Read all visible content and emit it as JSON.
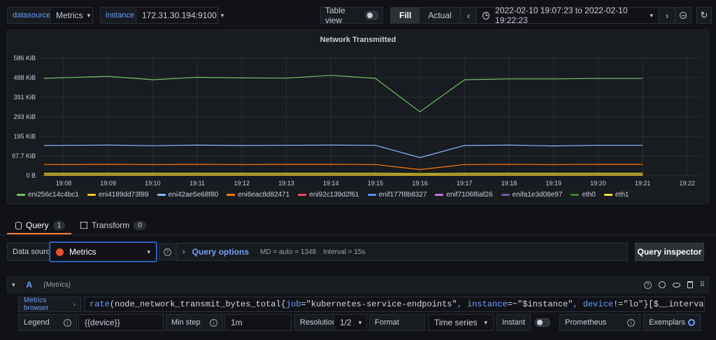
{
  "toolbar": {
    "datasource_label": "datasource",
    "datasource_value": "Metrics",
    "instance_label": "instance",
    "instance_value": "172.31.30.194:9100",
    "table_view_label": "Table view",
    "fill_label": "Fill",
    "actual_label": "Actual",
    "time_range": "2022-02-10 19:07:23 to 2022-02-10 19:22:23"
  },
  "panel": {
    "title": "Network Transmitted"
  },
  "chart_data": {
    "type": "line",
    "title": "Network Transmitted",
    "x": [
      "19:08",
      "19:09",
      "19:10",
      "19:11",
      "19:12",
      "19:13",
      "19:14",
      "19:15",
      "19:16",
      "19:17",
      "19:18",
      "19:19",
      "19:20",
      "19:21",
      "19:22"
    ],
    "y_ticks": [
      "0 B",
      "97.7 KiB",
      "195 KiB",
      "293 KiB",
      "391 KiB",
      "488 KiB",
      "586 KiB"
    ],
    "ylim": [
      0,
      586
    ],
    "series": [
      {
        "name": "eni256c14c4bc1",
        "color": "#73bf69",
        "values": [
          485,
          495,
          478,
          490,
          487,
          486,
          500,
          485,
          318,
          478,
          482,
          482,
          484,
          484
        ]
      },
      {
        "name": "eni4189dd73f89",
        "color": "#f2cc0c",
        "values": [
          2,
          2,
          2,
          2,
          2,
          2,
          2,
          2,
          2,
          2,
          2,
          2,
          2,
          2
        ]
      },
      {
        "name": "eni42ae5e68f80",
        "color": "#8ab8ff",
        "values": [
          150,
          152,
          149,
          152,
          150,
          151,
          152,
          151,
          90,
          150,
          152,
          148,
          151,
          151
        ]
      },
      {
        "name": "eni6eac8d82471",
        "color": "#ff780a",
        "values": [
          55,
          56,
          55,
          56,
          55,
          56,
          56,
          55,
          30,
          55,
          56,
          55,
          56,
          56
        ]
      },
      {
        "name": "eni92c139d2f61",
        "color": "#f2495c",
        "values": [
          4,
          4,
          4,
          4,
          4,
          4,
          4,
          4,
          3,
          4,
          4,
          4,
          4,
          4
        ]
      },
      {
        "name": "enif177f8b8327",
        "color": "#5794f2",
        "values": [
          3,
          3,
          3,
          3,
          3,
          3,
          3,
          3,
          2,
          3,
          3,
          3,
          3,
          3
        ]
      },
      {
        "name": "enif7106f6af26",
        "color": "#b877d9",
        "values": [
          2,
          2,
          2,
          2,
          2,
          2,
          2,
          2,
          2,
          2,
          2,
          2,
          2,
          2
        ]
      },
      {
        "name": "enifa1e3d08e97",
        "color": "#705da0",
        "values": [
          1,
          1,
          1,
          1,
          1,
          1,
          1,
          1,
          1,
          1,
          1,
          1,
          1,
          1
        ]
      },
      {
        "name": "eth0",
        "color": "#37872d",
        "values": [
          8,
          8,
          8,
          8,
          8,
          8,
          8,
          8,
          6,
          8,
          8,
          8,
          8,
          8
        ]
      },
      {
        "name": "eth1",
        "color": "#fade2a",
        "values": [
          12,
          12,
          12,
          12,
          12,
          12,
          12,
          12,
          10,
          12,
          12,
          12,
          12,
          12
        ]
      }
    ],
    "grid": true,
    "legend": "bottom-left"
  },
  "tabs": [
    {
      "label": "Query",
      "count": "1"
    },
    {
      "label": "Transform",
      "count": "0"
    }
  ],
  "query_bar": {
    "data_source_label": "Data source",
    "data_source_value": "Metrics",
    "query_options_label": "Query options",
    "md_info": "MD = auto = 1348",
    "interval_info": "Interval = 15s",
    "query_inspector_label": "Query inspector"
  },
  "query": {
    "ref_id": "A",
    "datasource_hint": "(Metrics)",
    "metrics_browser_label": "Metrics browser",
    "expr_fn": "rate",
    "expr_metric": "(node_network_transmit_bytes_total{",
    "expr_k1": "job",
    "expr_v1": "=\"kubernetes-service-endpoints\"",
    "expr_k2": ", instance",
    "expr_v2": "=~\"$instance\"",
    "expr_k3": ", device",
    "expr_v3": "!=\"lo\"",
    "expr_tail": "}[$__interval])",
    "legend_label": "Legend",
    "legend_value": "{{device}}",
    "min_step_label": "Min step",
    "min_step_value": "1m",
    "resolution_label": "Resolution",
    "resolution_value": "1/2",
    "format_label": "Format",
    "format_value": "Time series",
    "instant_label": "Instant",
    "prometheus_label": "Prometheus",
    "exemplars_label": "Exemplars"
  },
  "icons": {
    "clock": "clock-icon",
    "zoom_out": "zoom-out-icon",
    "refresh": "refresh-icon",
    "database": "database-icon",
    "transform": "transform-icon"
  }
}
